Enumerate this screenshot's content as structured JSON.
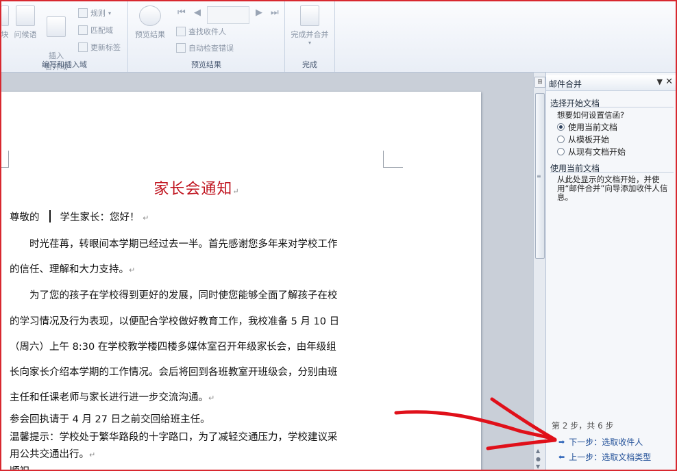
{
  "ribbon": {
    "group1": {
      "partial_label": "块",
      "greeting_label": "问候语",
      "insert_merge_field_label": "插入\n合并域",
      "rules_label": "规则",
      "match_fields_label": "匹配域",
      "update_labels_label": "更新标签",
      "group_label": "编写和插入域"
    },
    "group2": {
      "preview_results_label": "预览结果",
      "find_recipient_label": "查找收件人",
      "auto_check_errors_label": "自动检查错误",
      "group_label": "预览结果"
    },
    "group3": {
      "finish_merge_label": "完成并合并",
      "group_label": "完成"
    }
  },
  "document": {
    "title": "家长会通知",
    "lines": [
      {
        "before": "尊敬的",
        "after": "学生家长：您好！"
      },
      "　　时光荏苒，转眼间本学期已经过去一半。首先感谢您多年来对学校工作",
      "的信任、理解和大力支持。",
      "　　为了您的孩子在学校得到更好的发展，同时使您能够全面了解孩子在校",
      "的学习情况及行为表现，以便配合学校做好教育工作，我校准备 5 月 10 日",
      "（周六）上午  8:30  在学校教学楼四楼多媒体室召开年级家长会，由年级组",
      "长向家长介绍本学期的工作情况。会后将回到各班教室开班级会，分别由班",
      "主任和任课老师与家长进行进一步交流沟通。",
      "参会回执请于 4 月 27 日之前交回给班主任。",
      "温馨提示：学校处于繁华路段的十字路口，为了减轻交通压力，学校建议采",
      "用公共交通出行。",
      "顺祝"
    ],
    "para_mark": "↵"
  },
  "pane": {
    "title": "邮件合并",
    "section1": "选择开始文档",
    "question": "想要如何设置信函?",
    "options": [
      "使用当前文档",
      "从模板开始",
      "从现有文档开始"
    ],
    "selected_index": 0,
    "section2": "使用当前文档",
    "description": "从此处显示的文档开始，并使用“邮件合并”向导添加收件人信息。",
    "step": "第 2 步，共 6 步",
    "next_link": "下一步：选取收件人",
    "prev_link": "上一步：选取文档类型"
  },
  "colors": {
    "title_red": "#c0141f",
    "annotation_red": "#e0101a",
    "link_blue": "#1f4e97"
  }
}
